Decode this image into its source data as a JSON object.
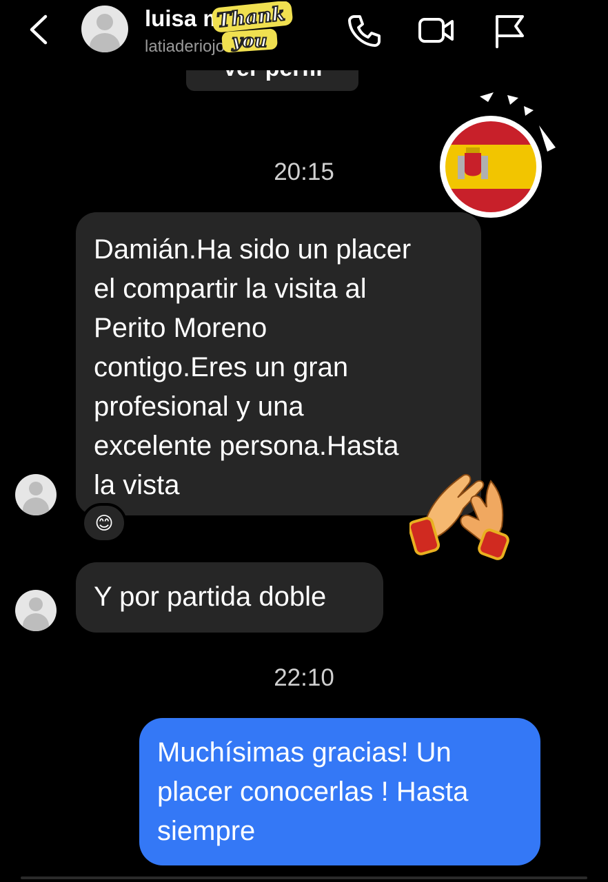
{
  "header": {
    "name": "luisa mateo",
    "handle": "latiaderiojo",
    "sticker_line1": "Thank",
    "sticker_line2": "you"
  },
  "profile_button_label": "Ver perfil",
  "timestamps": [
    "20:15",
    "22:10"
  ],
  "messages": [
    {
      "side": "incoming",
      "lines": [
        "Damián.Ha sido un placer",
        "el compartir la visita al",
        "Perito Moreno",
        "contigo.Eres un gran",
        "profesional y una",
        "excelente persona.Hasta",
        "la vista"
      ],
      "reaction": "😊"
    },
    {
      "side": "incoming",
      "lines": [
        "Y por partida doble"
      ]
    },
    {
      "side": "outgoing",
      "lines": [
        "Muchísimas gracias! Un",
        "placer conocerlas ! Hasta",
        "siempre"
      ]
    }
  ],
  "icons": [
    "back-chevron-icon",
    "phone-icon",
    "video-camera-icon",
    "flag-icon",
    "spain-flag-sticker",
    "clapping-hands-sticker"
  ],
  "colors": {
    "background": "#000000",
    "incoming_bubble": "#262626",
    "outgoing_bubble": "#3478f6",
    "timestamp": "#d0d0d0"
  }
}
